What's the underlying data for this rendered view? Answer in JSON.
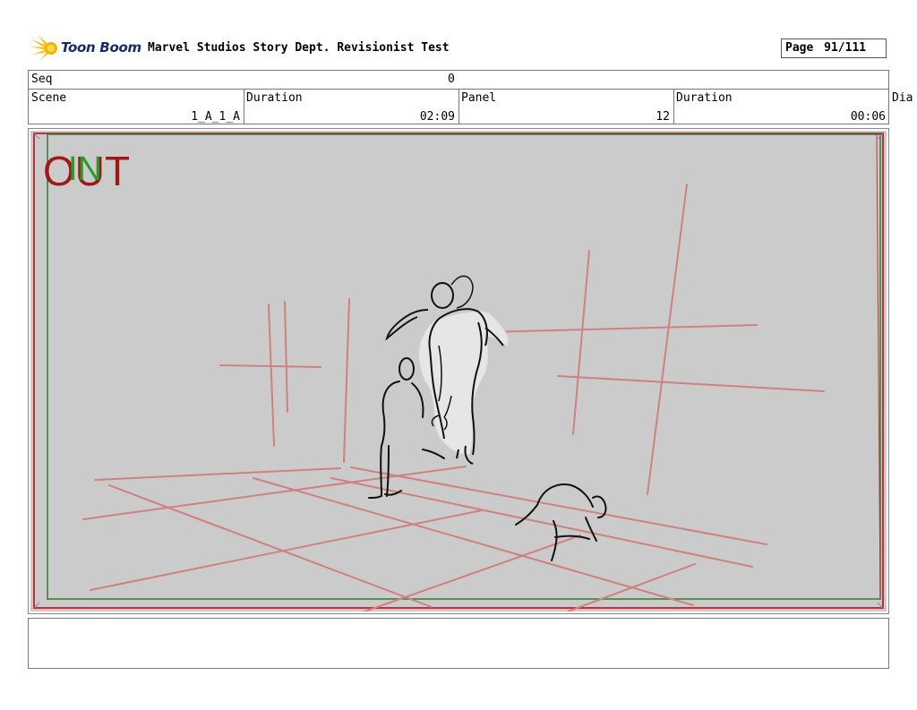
{
  "header": {
    "logo_text": "Toon Boom",
    "title": "Marvel Studios Story Dept. Revisionist Test",
    "page_label": "Page",
    "page_value": "91/111"
  },
  "info": {
    "seq_label": "Seq",
    "seq_value": "0",
    "scene_label": "Scene",
    "scene_value": "1_A_1_A",
    "duration_label": "Duration",
    "duration_value": "02:09",
    "panel_label": "Panel",
    "panel_value": "12",
    "panel_duration_label": "Duration",
    "panel_duration_value": "00:06",
    "dialogue_label": "Dia"
  },
  "panel": {
    "in_marker": "IN",
    "out_marker": "OUT",
    "background_color": "#cbcbcb",
    "grid_color": "#d08080",
    "safe_frame_color": "#2e7d2e",
    "frame_color": "#c0303a"
  },
  "notes": {
    "text": ""
  }
}
